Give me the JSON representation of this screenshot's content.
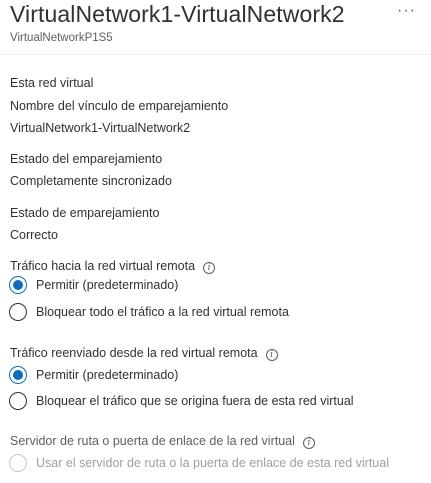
{
  "header": {
    "title": "VirtualNetwork1-VirtualNetwork2",
    "subtitle": "VirtualNetworkP1S5",
    "more_label": "···"
  },
  "details": {
    "section_label": "Esta red virtual",
    "peering_name_label": "Nombre del vínculo de emparejamiento",
    "peering_name_value": "VirtualNetwork1-VirtualNetwork2",
    "peering_status_label": "Estado del emparejamiento",
    "peering_status_value": "Completamente sincronizado",
    "peering_state_label": "Estado de emparejamiento",
    "peering_state_value": "Correcto"
  },
  "remote_traffic": {
    "label": "Tráfico hacia la red virtual remota",
    "options": [
      "Permitir (predeterminado)",
      "Bloquear todo el tráfico a la red virtual remota"
    ],
    "selected": "Permitir (predeterminado)"
  },
  "forwarded_traffic": {
    "label": "Tráfico reenviado desde la red virtual remota",
    "options": [
      "Permitir (predeterminado)",
      "Bloquear el tráfico que se origina fuera de esta red virtual"
    ],
    "selected": "Permitir (predeterminado)"
  },
  "gateway": {
    "label": "Servidor de ruta o puerta de enlace de la red virtual",
    "option": "Usar el servidor de ruta o la puerta de enlace de esta red virtual",
    "disabled": true
  },
  "colors": {
    "accent": "#0f6cbd",
    "text": "#323130",
    "muted": "#605e5c",
    "disabled": "#a19f9d"
  }
}
